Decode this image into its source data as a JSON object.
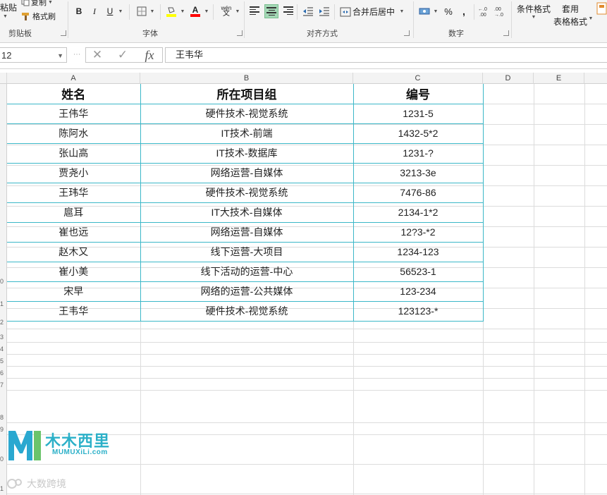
{
  "ribbon": {
    "clipboard": {
      "paste": "粘贴",
      "copy": "复制",
      "format_painter": "格式刷",
      "group": "剪贴板"
    },
    "font": {
      "bold": "B",
      "italic": "I",
      "underline": "U",
      "font_color_glyph": "A",
      "phonetic": "wén",
      "group": "字体",
      "highlight_color": "#ffff00",
      "font_color": "#ff0000"
    },
    "alignment": {
      "merge_center": "合并后居中",
      "group": "对齐方式"
    },
    "number": {
      "percent": "%",
      "comma": ",",
      "group": "数字"
    },
    "styles": {
      "conditional": "条件格式",
      "table_format_1": "套用",
      "table_format_2": "表格格式"
    }
  },
  "formula_bar": {
    "name_box": "12",
    "fx": "fx",
    "cancel": "✕",
    "enter": "✓",
    "content": "王韦华"
  },
  "columns": [
    "A",
    "B",
    "C",
    "D",
    "E"
  ],
  "table": {
    "headers": [
      "姓名",
      "所在项目组",
      "编号"
    ],
    "rows": [
      [
        "王伟华",
        "硬件技术-视觉系统",
        "1231-5"
      ],
      [
        "陈阿水",
        "IT技术-前端",
        "1432-5*2"
      ],
      [
        "张山高",
        "IT技术-数据库",
        "1231-?"
      ],
      [
        "贾尧小",
        "网络运营-自媒体",
        "3213-3e"
      ],
      [
        "王玮华",
        "硬件技术-视觉系统",
        "7476-86"
      ],
      [
        "扈耳",
        "IT大技术-自媒体",
        "2134-1*2"
      ],
      [
        "崔也远",
        "网络运营-自媒体",
        "12?3-*2"
      ],
      [
        "赵木又",
        "线下运营-大项目",
        "1234-123"
      ],
      [
        "崔小美",
        "线下活动的运营-中心",
        "56523-1"
      ],
      [
        "宋早",
        "网络的运营-公共媒体",
        "123-234"
      ],
      [
        "王韦华",
        "硬件技术-视觉系统",
        "123123-*"
      ]
    ]
  },
  "row_numbers": [
    "0",
    "1",
    "2",
    "3",
    "4",
    "5",
    "6",
    "7",
    "8",
    "9",
    "0",
    "1"
  ],
  "watermark": {
    "name": "木木西里",
    "sub": "MUMUXiLi.com",
    "brand2": "大数跨境"
  }
}
